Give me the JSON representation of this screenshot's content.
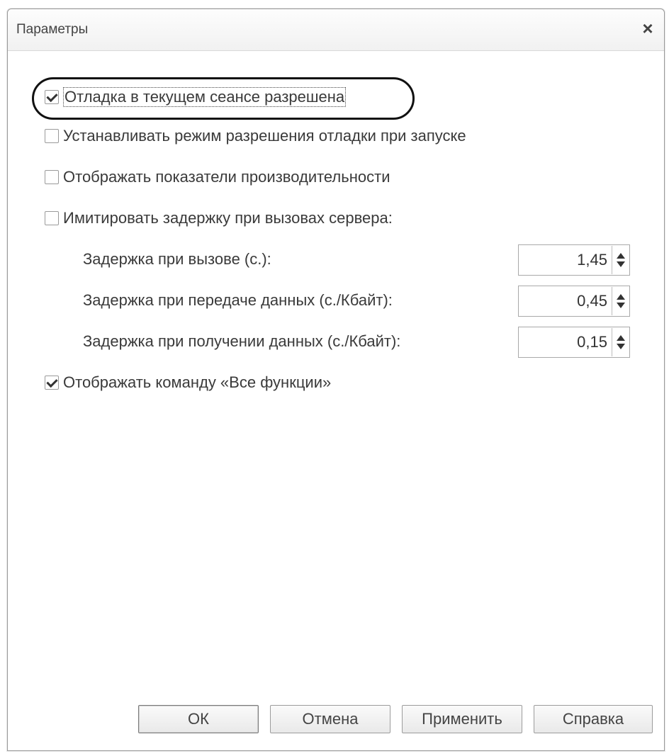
{
  "window": {
    "title": "Параметры"
  },
  "options": {
    "debug_session": {
      "label": "Отладка в текущем сеансе разрешена",
      "checked": true
    },
    "debug_startup": {
      "label": "Устанавливать режим разрешения отладки при запуске",
      "checked": false
    },
    "perf_indicators": {
      "label": "Отображать показатели производительности",
      "checked": false
    },
    "simulate_delay": {
      "label": "Имитировать задержку при вызовах сервера:",
      "checked": false
    },
    "all_functions": {
      "label": "Отображать команду «Все функции»",
      "checked": true
    }
  },
  "delays": [
    {
      "label": "Задержка при вызове (с.):",
      "value": "1,45"
    },
    {
      "label": "Задержка при передаче данных (с./Кбайт):",
      "value": "0,45"
    },
    {
      "label": "Задержка при получении данных (с./Кбайт):",
      "value": "0,15"
    }
  ],
  "buttons": {
    "ok": "ОК",
    "cancel": "Отмена",
    "apply": "Применить",
    "help": "Справка"
  }
}
